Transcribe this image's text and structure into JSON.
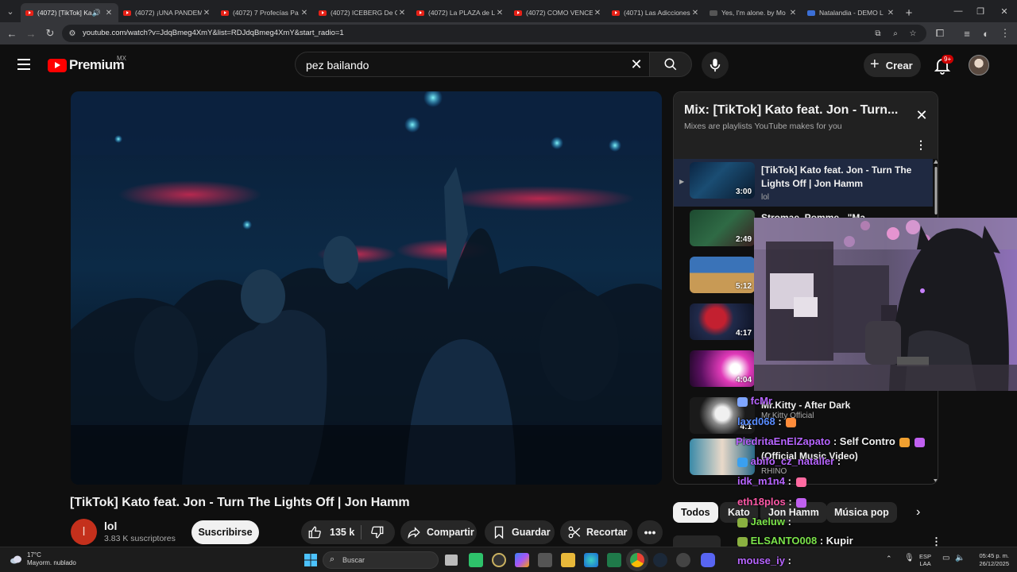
{
  "browser": {
    "tabs": [
      {
        "label": "(4072) [TikTok] Ka",
        "active": true
      },
      {
        "label": "(4072) ¡UNA PANDEM",
        "active": false
      },
      {
        "label": "(4072) 7 Profecías Pa",
        "active": false
      },
      {
        "label": "(4072) ICEBERG De C",
        "active": false
      },
      {
        "label": "(4072) La PLAZA de L",
        "active": false
      },
      {
        "label": "(4072) COMO VENCE",
        "active": false
      },
      {
        "label": "(4071) Las Adicciones",
        "active": false
      },
      {
        "label": "Yes, I'm alone. by Mo",
        "active": false
      },
      {
        "label": "Natalandia - DEMO L",
        "active": false
      }
    ],
    "url": "youtube.com/watch?v=JdqBmeg4XmY&list=RDJdqBmeg4XmY&start_radio=1"
  },
  "header": {
    "logo_text": "Premium",
    "country": "MX",
    "search_value": "pez bailando",
    "create_label": "Crear",
    "notifications_badge": "9+"
  },
  "video": {
    "title": "[TikTok] Kato feat. Jon - Turn The Lights Off | Jon Hamm",
    "channel_initial": "l",
    "channel_name": "lol",
    "channel_subs": "3.83 K suscriptores",
    "subscribe_label": "Suscribirse",
    "likes": "135 k",
    "share_label": "Compartir",
    "save_label": "Guardar",
    "clip_label": "Recortar"
  },
  "playlist": {
    "title": "Mix: [TikTok] Kato feat. Jon - Turn...",
    "subtitle": "Mixes are playlists YouTube makes for you",
    "items": [
      {
        "title": "[TikTok] Kato feat. Jon - Turn The Lights Off | Jon Hamm",
        "channel": "lol",
        "duration": "3:00",
        "active": true
      },
      {
        "title": "Stromae, Pomme - \"Ma",
        "channel": "",
        "duration": "2:49",
        "active": false
      },
      {
        "title": "",
        "channel": "",
        "duration": "5:12",
        "active": false
      },
      {
        "title": "",
        "channel": "",
        "duration": "4:17",
        "active": false
      },
      {
        "title": "",
        "channel": "",
        "duration": "4:04",
        "active": false
      },
      {
        "title": "Mr.Kitty - After Dark",
        "channel": "Mr.Kitty Official",
        "duration": "4:1",
        "active": false
      },
      {
        "title": "(Official Music Video)",
        "channel": "RHINO",
        "duration": "",
        "active": false
      }
    ]
  },
  "chips": [
    "Todos",
    "Kato",
    "Jon Hamm",
    "Música pop"
  ],
  "chat": [
    {
      "user": "fcMr",
      "msg": ""
    },
    {
      "user": "laxd068",
      "msg": ":"
    },
    {
      "user": "PiedritaEnElZapato",
      "msg": ": Self Contro"
    },
    {
      "user": "abifo_cz_nataller",
      "msg": ":"
    },
    {
      "user": "idk_m1n4",
      "msg": ":"
    },
    {
      "user": "eth18plos",
      "msg": ":"
    },
    {
      "user": "Jaeluw",
      "msg": ":"
    },
    {
      "user": "ELSANTO008",
      "msg": ": Kupir"
    },
    {
      "user": "mouse_iy",
      "msg": ":"
    }
  ],
  "colors": {
    "accent_red": "#ff0000",
    "playlist_active": "#1f2941",
    "chat_purple": "#b765ff",
    "chat_blue": "#5a8dff",
    "chat_green": "#7be34a"
  },
  "taskbar": {
    "temperature": "17°C",
    "weather": "Mayorm. nublado",
    "search_placeholder": "Buscar",
    "lang": "ESP",
    "lang2": "LAA",
    "time": "05:45 p. m.",
    "date": "26/12/2025"
  }
}
